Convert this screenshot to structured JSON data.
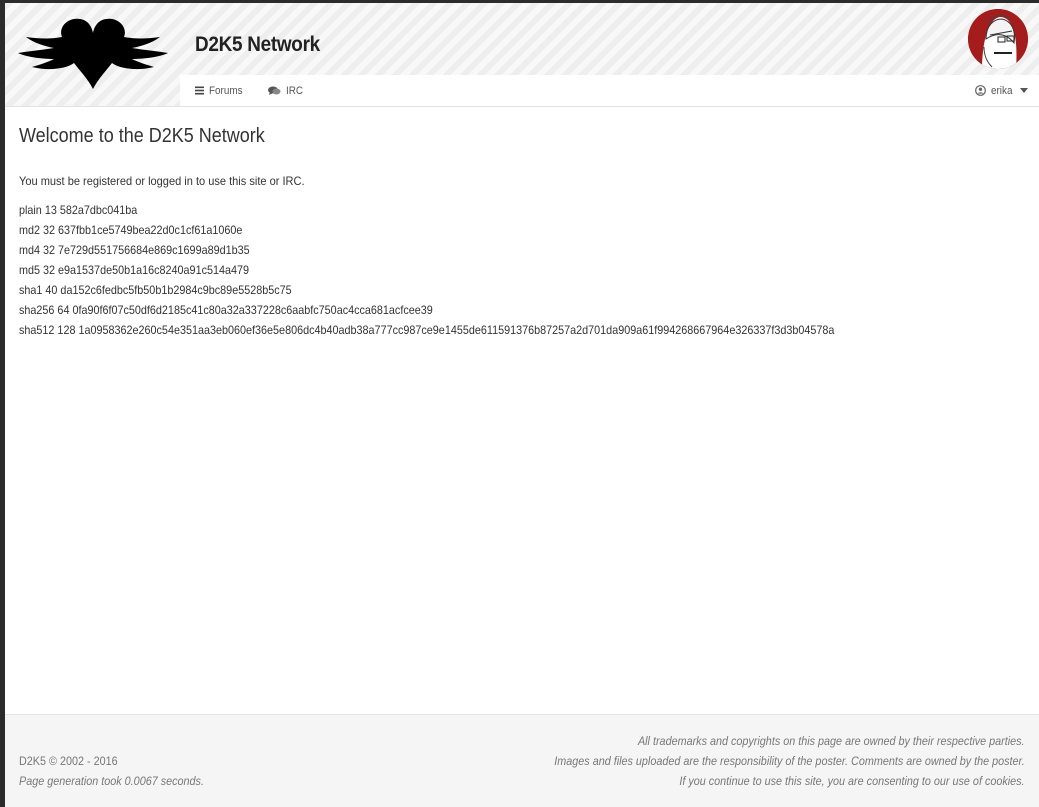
{
  "header": {
    "site_title": "D2K5 Network",
    "logo_icon": "winged-heart-logo",
    "avatar_icon": "user-avatar"
  },
  "nav": {
    "forums_label": "Forums",
    "irc_label": "IRC",
    "user_label": "erika"
  },
  "main": {
    "heading": "Welcome to the D2K5 Network",
    "intro": "You must be registered or logged in to use this site or IRC.",
    "hashes": [
      "plain 13 582a7dbc041ba",
      "md2 32 637fbb1ce5749bea22d0c1cf61a1060e",
      "md4 32 7e729d551756684e869c1699a89d1b35",
      "md5 32 e9a1537de50b1a16c8240a91c514a479",
      "sha1 40 da152c6fedbc5fb50b1b2984c9bc89e5528b5c75",
      "sha256 64 0fa90f6f07c50df6d2185c41c80a32a337228c6aabfc750ac4cca681acfcee39",
      "sha512 128 1a0958362e260c54e351aa3eb060ef36e5e806dc4b40adb38a777cc987ce9e1455de611591376b87257a2d701da909a61f994268667964e326337f3d3b04578a"
    ]
  },
  "footer": {
    "copyright": "D2K5 © 2002 - 2016",
    "generation": "Page generation took 0.0067 seconds.",
    "notice_1": "All trademarks and copyrights on this page are owned by their respective parties.",
    "notice_2": "Images and files uploaded are the responsibility of the poster. Comments are owned by the poster.",
    "notice_3": "If you continue to use this site, you are consenting to our use of cookies."
  }
}
